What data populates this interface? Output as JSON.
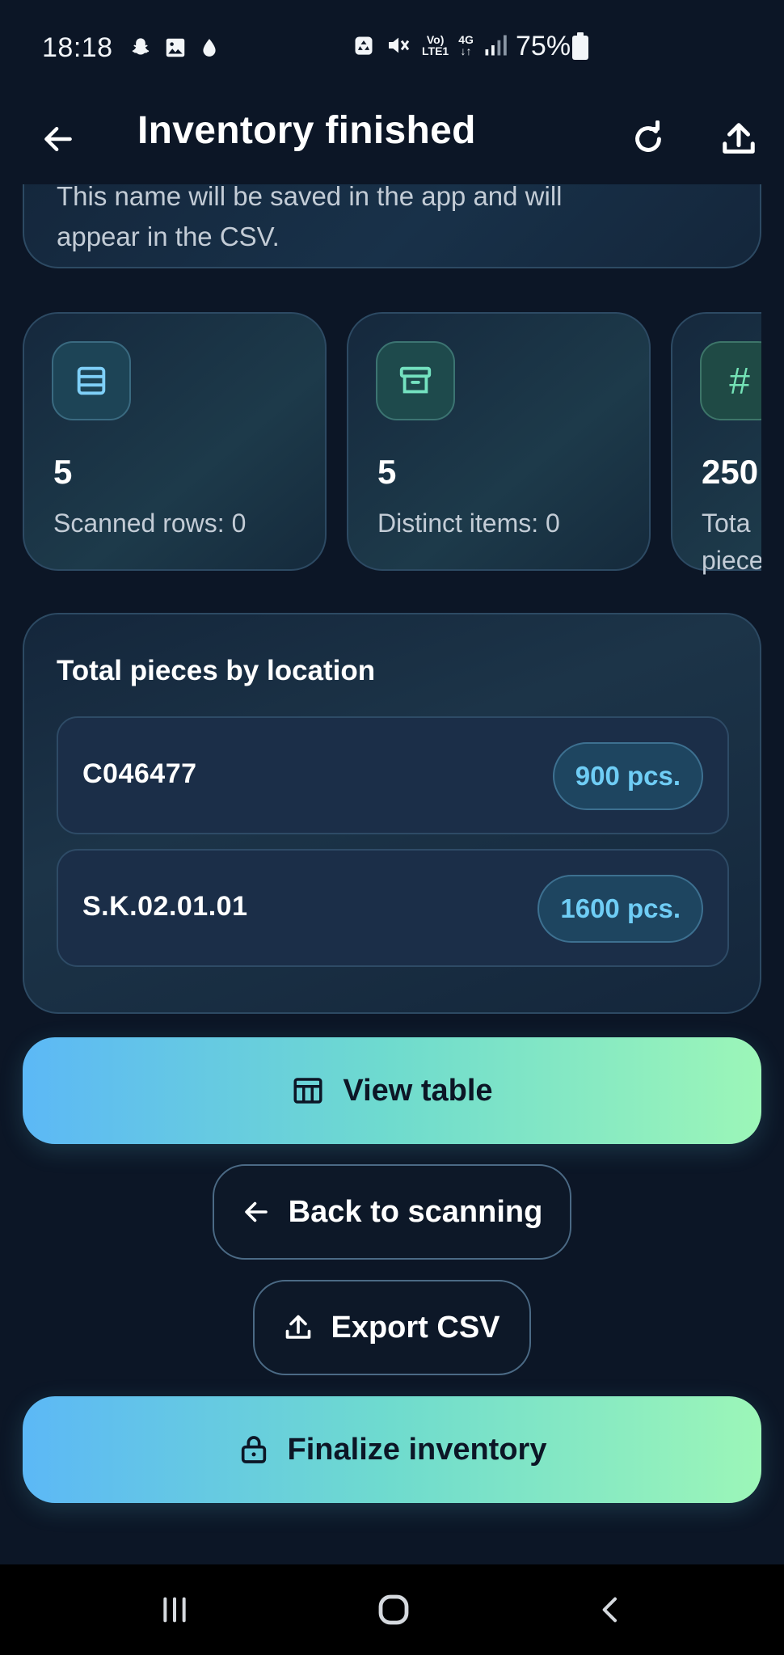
{
  "status_bar": {
    "time": "18:18",
    "network_label_top": "Vo)",
    "network_label_bottom": "LTE1",
    "net_type": "4G",
    "battery": "75%"
  },
  "header": {
    "title": "Inventory finished"
  },
  "name_card": {
    "hint_line1": "This name will be saved in the app and will",
    "hint_line2": "appear in the CSV."
  },
  "stats": [
    {
      "value": "5",
      "label": "Scanned rows: 0",
      "icon": "rows-icon"
    },
    {
      "value": "5",
      "label": "Distinct items: 0",
      "icon": "archive-icon"
    },
    {
      "value": "250",
      "label_line1": "Tota",
      "label_line2": "piece",
      "icon": "hash-icon",
      "icon_glyph": "#"
    }
  ],
  "locations": {
    "title": "Total pieces by location",
    "rows": [
      {
        "code": "C046477",
        "count": "900 pcs."
      },
      {
        "code": "S.K.02.01.01",
        "count": "1600 pcs."
      }
    ]
  },
  "actions": {
    "view_table": "View table",
    "back_to_scanning": "Back to scanning",
    "export_csv": "Export CSV",
    "finalize_inventory": "Finalize inventory"
  },
  "colors": {
    "background": "#0c1626",
    "accent_start": "#5cb8f6",
    "accent_end": "#9cf6b8",
    "pill_text": "#6fcdf5"
  }
}
